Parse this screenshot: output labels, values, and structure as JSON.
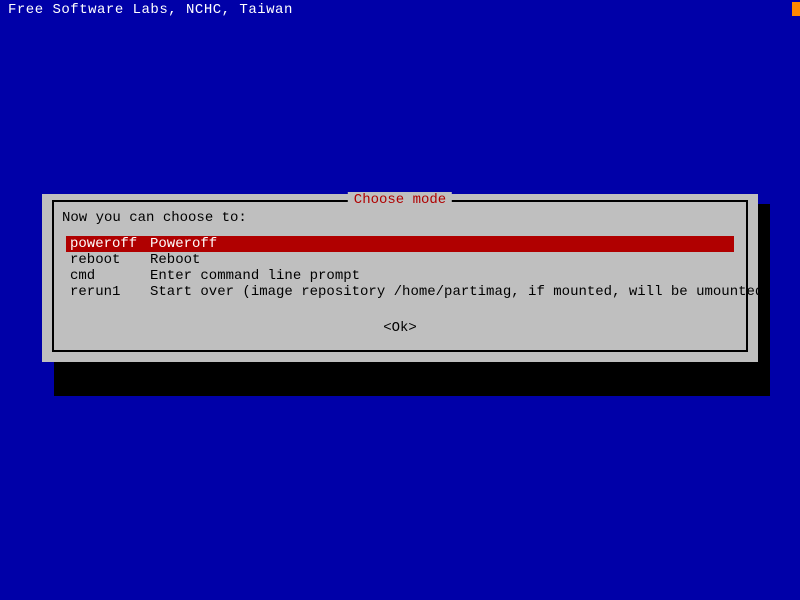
{
  "header": "Free Software Labs, NCHC, Taiwan",
  "dialog": {
    "title": "Choose mode",
    "prompt": "Now you can choose to:",
    "items": [
      {
        "key": "poweroff",
        "desc": "Poweroff",
        "selected": true
      },
      {
        "key": "reboot",
        "desc": "Reboot",
        "selected": false
      },
      {
        "key": "cmd",
        "desc": "Enter command line prompt",
        "selected": false
      },
      {
        "key": "rerun1",
        "desc": "Start over (image repository /home/partimag, if mounted, will be umounted)",
        "selected": false
      }
    ],
    "ok": "<Ok>"
  }
}
